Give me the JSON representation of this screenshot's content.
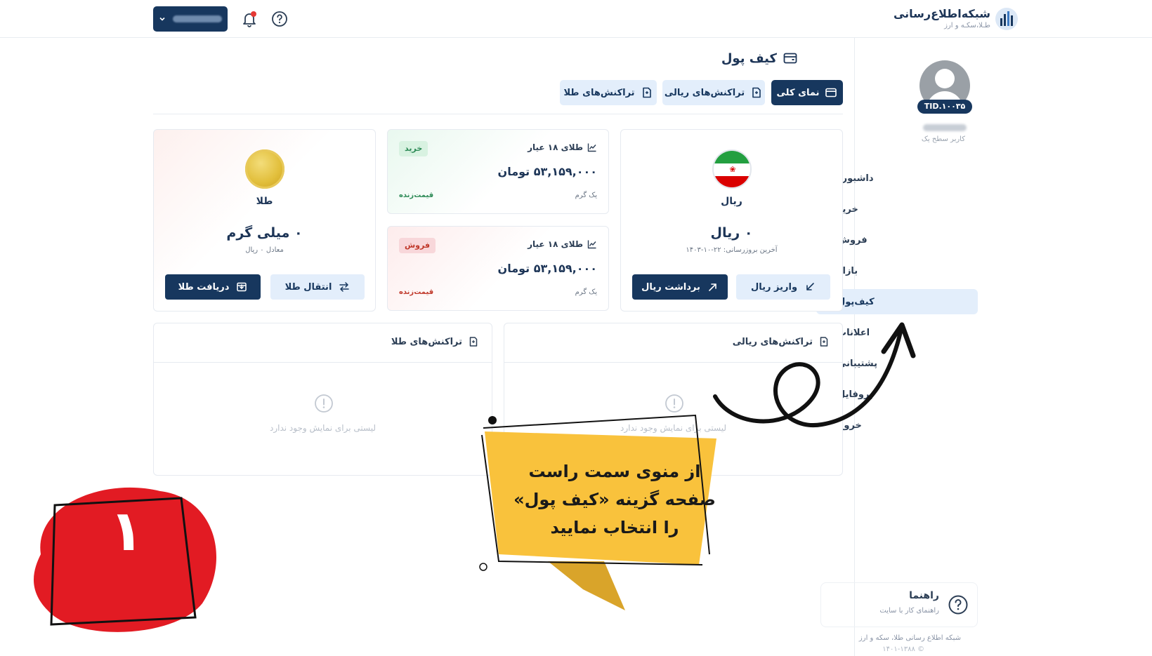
{
  "header": {
    "brand_title": "شبکه‌اطلاع‌رسانی",
    "brand_sub": "طـلا،سکـه و ارز",
    "user_menu_icon": "chevron-down-icon",
    "notification_icon": "bell-icon",
    "help_icon": "question-circle-icon"
  },
  "sidebar": {
    "user_id": "TID.۱۰۰۳۵",
    "user_level": "کاربر سطح یک",
    "items": [
      {
        "label": "داشبورد",
        "icon": "home-icon"
      },
      {
        "label": "خرید",
        "icon": "cart-icon"
      },
      {
        "label": "فروش",
        "icon": "cart-icon"
      },
      {
        "label": "بازار",
        "icon": "market-icon"
      },
      {
        "label": "کیف‌پول",
        "icon": "wallet-icon"
      },
      {
        "label": "اعلانات",
        "icon": "bell-icon"
      },
      {
        "label": "پشتیبانی",
        "icon": "chat-icon"
      },
      {
        "label": "پروفایل",
        "icon": "user-circle-icon"
      },
      {
        "label": "خروج",
        "icon": "power-icon"
      }
    ],
    "active_item": "کیف‌پول",
    "help_card": {
      "title": "راهنما",
      "subtitle": "راهنمای کار با سایت"
    },
    "footer": {
      "line1": "شبکه اطلاع رسانی طلا، سکه و ارز",
      "line2": "© ۱۴۰۱-۱۳۸۸"
    }
  },
  "main": {
    "page_title": "کیف پول",
    "tabs": [
      {
        "label": "نمای کلی",
        "active": true
      },
      {
        "label": "تراکنش‌های ریالی",
        "active": false
      },
      {
        "label": "تراکنش‌های طلا",
        "active": false
      }
    ],
    "rial_card": {
      "label": "ریال",
      "amount": "۰ ریال",
      "last_update": "آخرین بروزرسانی: ۲۲-۱۰-۱۴۰۳",
      "deposit_label": "واریز ریال",
      "withdraw_label": "برداشت ریال"
    },
    "buy_price": {
      "title": "طلای ۱۸ عیار",
      "badge": "خرید",
      "value": "۵۳,۱۵۹,۰۰۰ تومان",
      "unit": "یک گرم",
      "live": "قیمت‌زنده"
    },
    "sell_price": {
      "title": "طلای ۱۸ عیار",
      "badge": "فروش",
      "value": "۵۳,۱۵۹,۰۰۰ تومان",
      "unit": "یک گرم",
      "live": "قیمت‌زنده"
    },
    "gold_card": {
      "label": "طلا",
      "amount": "۰ میلی گرم",
      "equivalent": "معادل ۰ ریال",
      "transfer_label": "انتقال طلا",
      "receive_label": "دریافت طلا"
    },
    "rial_transactions": {
      "title": "تراکنش‌های ریالی",
      "empty": "لیستی برای نمایش وجود ندارد"
    },
    "gold_transactions": {
      "title": "تراکنش‌های طلا",
      "empty": "لیستی برای نمایش وجود ندارد"
    }
  },
  "overlay": {
    "instruction": "از منوی سمت راست صفحه گزینه «کیف پول» را انتخاب نمایید",
    "step_number": "۱"
  },
  "colors": {
    "primary": "#17375e",
    "tab_light": "#e3eefb",
    "buy": "#2e8b57",
    "sell": "#c0392b",
    "banner": "#f9c23c",
    "step": "#e21b23"
  }
}
